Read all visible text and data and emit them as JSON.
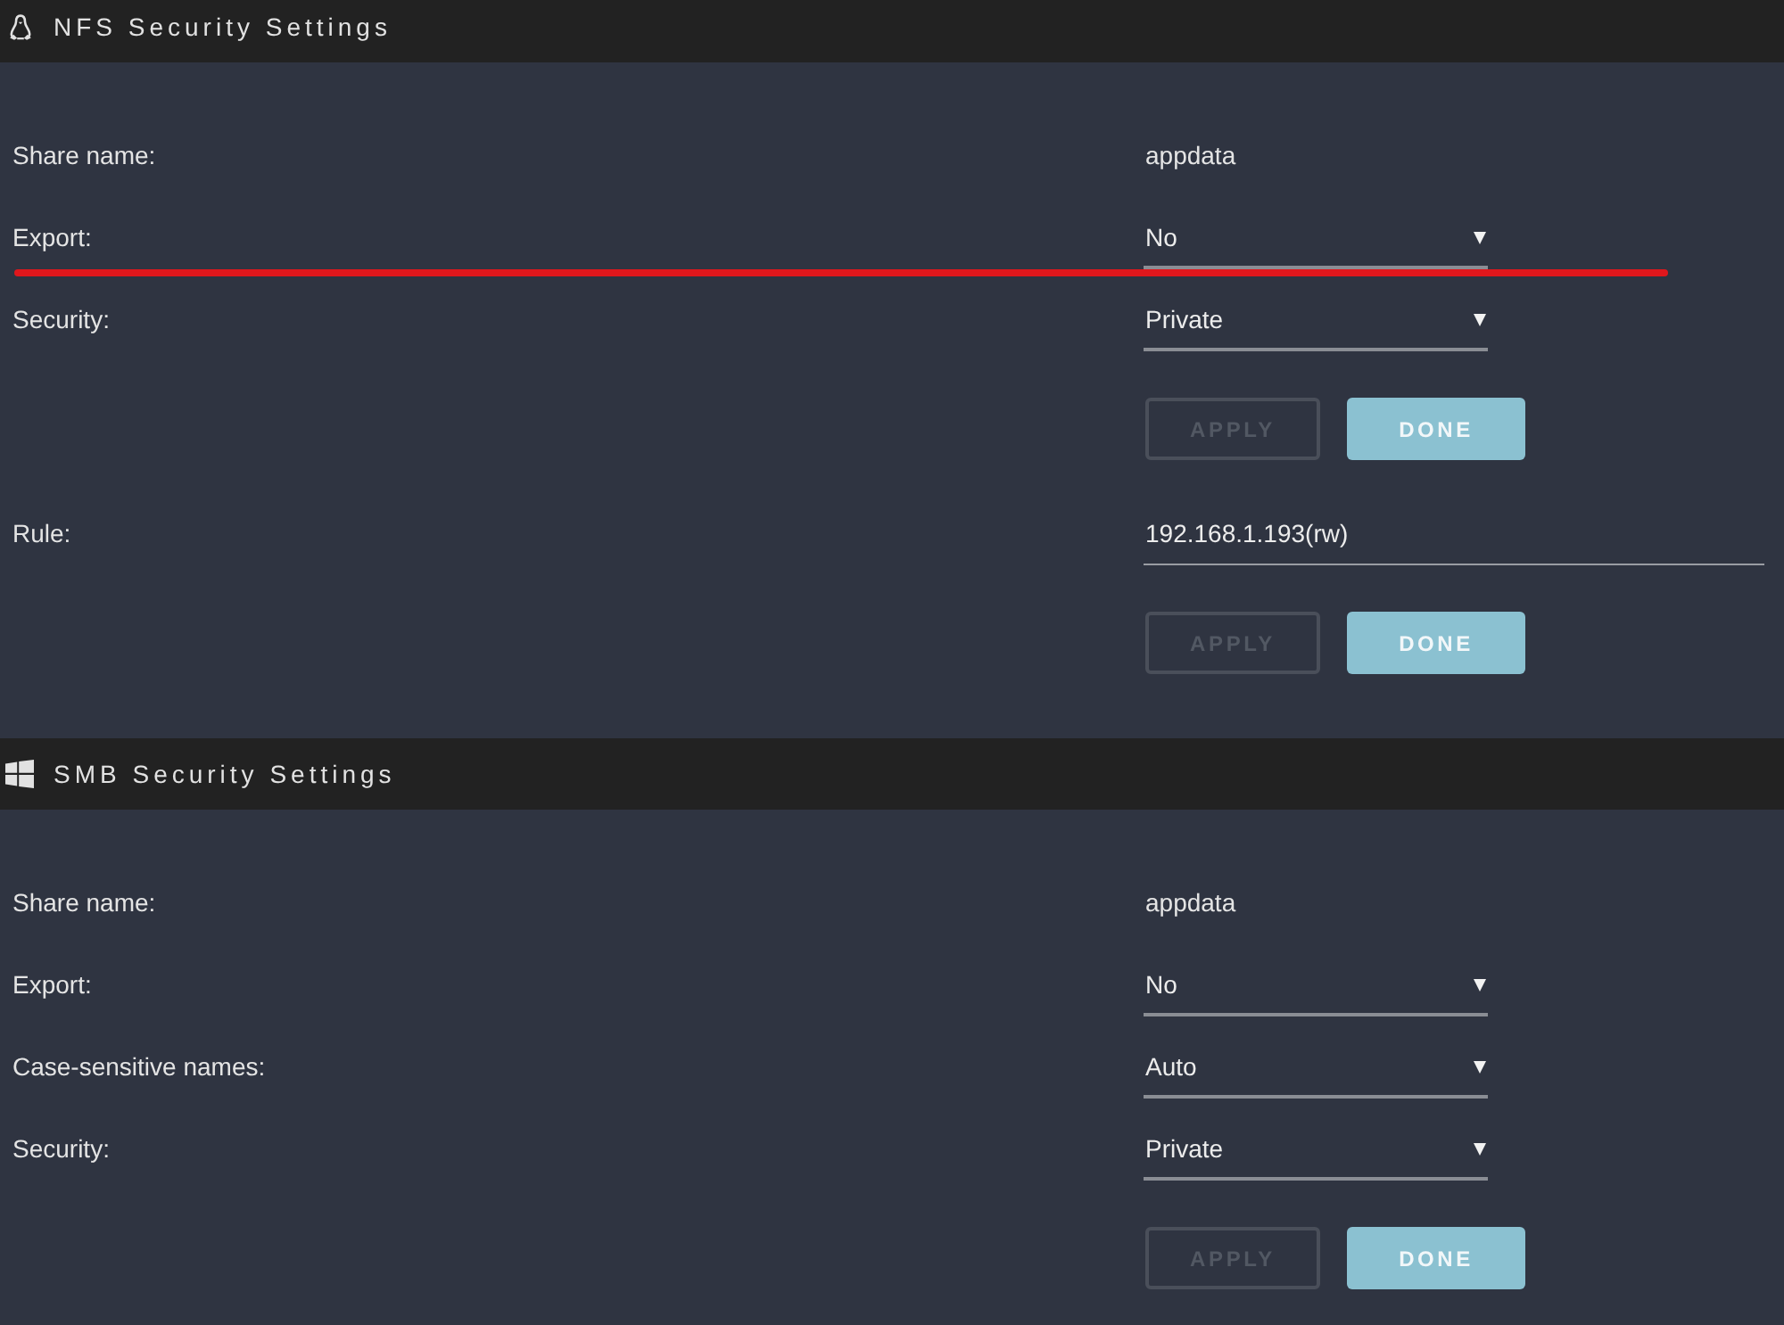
{
  "sections": [
    {
      "kind": "linux",
      "title": "NFS Security Settings",
      "rows": [
        {
          "kind": "text",
          "label": "Share name:",
          "value": "appdata",
          "marked": false
        },
        {
          "kind": "select",
          "label": "Export:",
          "value": "No",
          "marked": true
        },
        {
          "kind": "select",
          "label": "Security:",
          "value": "Private",
          "marked": false
        },
        {
          "kind": "buttons",
          "buttons": [
            {
              "label": "APPLY",
              "disabled": true
            },
            {
              "label": "DONE",
              "disabled": false
            }
          ],
          "marked": false
        },
        {
          "kind": "input",
          "label": "Rule:",
          "value": "192.168.1.193(rw)",
          "marked": false
        },
        {
          "kind": "buttons",
          "buttons": [
            {
              "label": "APPLY",
              "disabled": true
            },
            {
              "label": "DONE",
              "disabled": false
            }
          ],
          "marked": false
        }
      ]
    },
    {
      "kind": "windows",
      "title": "SMB Security Settings",
      "rows": [
        {
          "kind": "text",
          "label": "Share name:",
          "value": "appdata",
          "marked": false
        },
        {
          "kind": "select",
          "label": "Export:",
          "value": "No",
          "marked": false
        },
        {
          "kind": "select",
          "label": "Case-sensitive names:",
          "value": "Auto",
          "marked": false
        },
        {
          "kind": "select",
          "label": "Security:",
          "value": "Private",
          "marked": false
        },
        {
          "kind": "buttons",
          "buttons": [
            {
              "label": "APPLY",
              "disabled": true
            },
            {
              "label": "DONE",
              "disabled": false
            }
          ],
          "marked": false
        }
      ]
    }
  ]
}
